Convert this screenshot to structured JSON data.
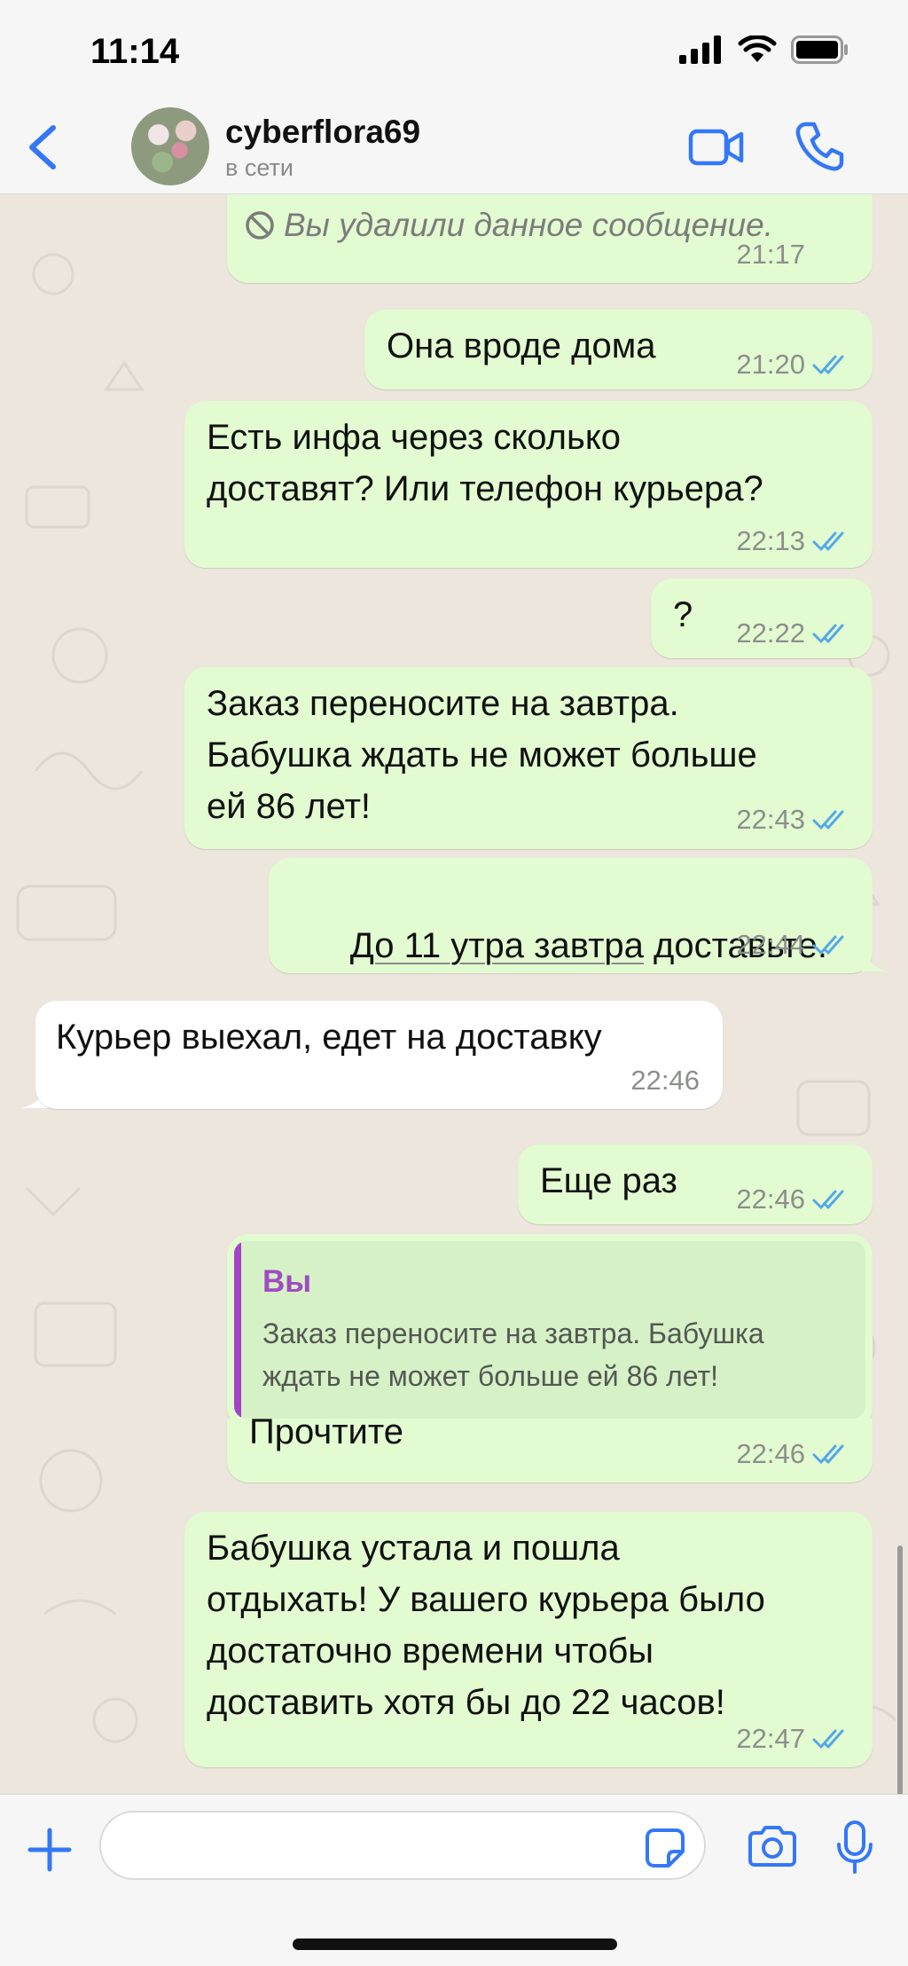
{
  "status_bar": {
    "time": "11:14"
  },
  "header": {
    "contact_name": "cyberflora69",
    "contact_status": "в сети"
  },
  "messages": [
    {
      "direction": "out",
      "deleted": true,
      "text": "Вы удалили данное сообщение.",
      "time": "21:17"
    },
    {
      "direction": "out",
      "text": "Она вроде дома",
      "time": "21:20",
      "read": true
    },
    {
      "direction": "out",
      "text": "Есть инфа через сколько\nдоставят? Или телефон курьера?",
      "time": "22:13",
      "read": true
    },
    {
      "direction": "out",
      "text": "?",
      "time": "22:22",
      "read": true
    },
    {
      "direction": "out",
      "text": "Заказ переносите на завтра.\nБабушка ждать не может больше\nей 86 лет!",
      "time": "22:43",
      "read": true
    },
    {
      "direction": "out",
      "text_link": "До 11 утра завтра",
      "text_rest": " доставьте.",
      "time": "22:44",
      "read": true
    },
    {
      "direction": "in",
      "text": "Курьер выехал, едет на доставку",
      "time": "22:46"
    },
    {
      "direction": "out",
      "text": "Еще раз",
      "time": "22:46",
      "read": true
    },
    {
      "direction": "out",
      "quote_author": "Вы",
      "quote_text": "Заказ переносите на завтра. Бабушка ждать не может больше ей 86 лет!",
      "text": "Прочтите",
      "time": "22:46",
      "read": true
    },
    {
      "direction": "out",
      "text": "Бабушка устала и пошла\nотдыхать! У вашего курьера было\nдостаточно времени чтобы\nдоставить хотя бы до 22 часов!",
      "time": "22:47",
      "read": true
    }
  ],
  "input": {
    "placeholder": ""
  },
  "colors": {
    "accent": "#3478f6",
    "outgoing_bubble": "#e2fbd0",
    "incoming_bubble": "#ffffff",
    "read_ticks": "#53a8e8",
    "quote_bar": "#a543c8"
  },
  "icons": {
    "back": "chevron-left-icon",
    "video": "video-camera-icon",
    "phone": "phone-icon",
    "deleted": "prohibited-icon",
    "attach": "plus-icon",
    "sticker": "sticker-icon",
    "camera": "camera-icon",
    "mic": "microphone-icon"
  }
}
